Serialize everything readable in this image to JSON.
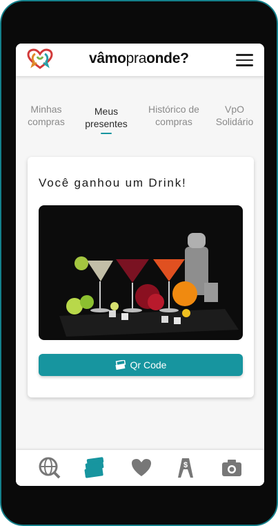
{
  "header": {
    "brand_part1": "vâmo",
    "brand_part2": "pra",
    "brand_part3": "onde?"
  },
  "tabs": [
    {
      "label_line1": "Minhas",
      "label_line2": "compras",
      "active": false
    },
    {
      "label_line1": "Meus",
      "label_line2": "presentes",
      "active": true
    },
    {
      "label_line1": "Histórico de",
      "label_line2": "compras",
      "active": false
    },
    {
      "label_line1": "VpO",
      "label_line2": "Solidário",
      "active": false
    }
  ],
  "gift_card": {
    "title": "Você ganhou um Drink!",
    "qr_button_label": "Qr Code"
  },
  "bottom_nav": [
    {
      "icon": "globe-search-icon",
      "active": false
    },
    {
      "icon": "tickets-icon",
      "active": true
    },
    {
      "icon": "heart-icon",
      "active": false
    },
    {
      "icon": "dollar-sign-board-icon",
      "active": false
    },
    {
      "icon": "camera-icon",
      "active": false
    }
  ],
  "colors": {
    "accent": "#17959f",
    "frame": "#137f8a",
    "nav_icon": "#777777"
  }
}
